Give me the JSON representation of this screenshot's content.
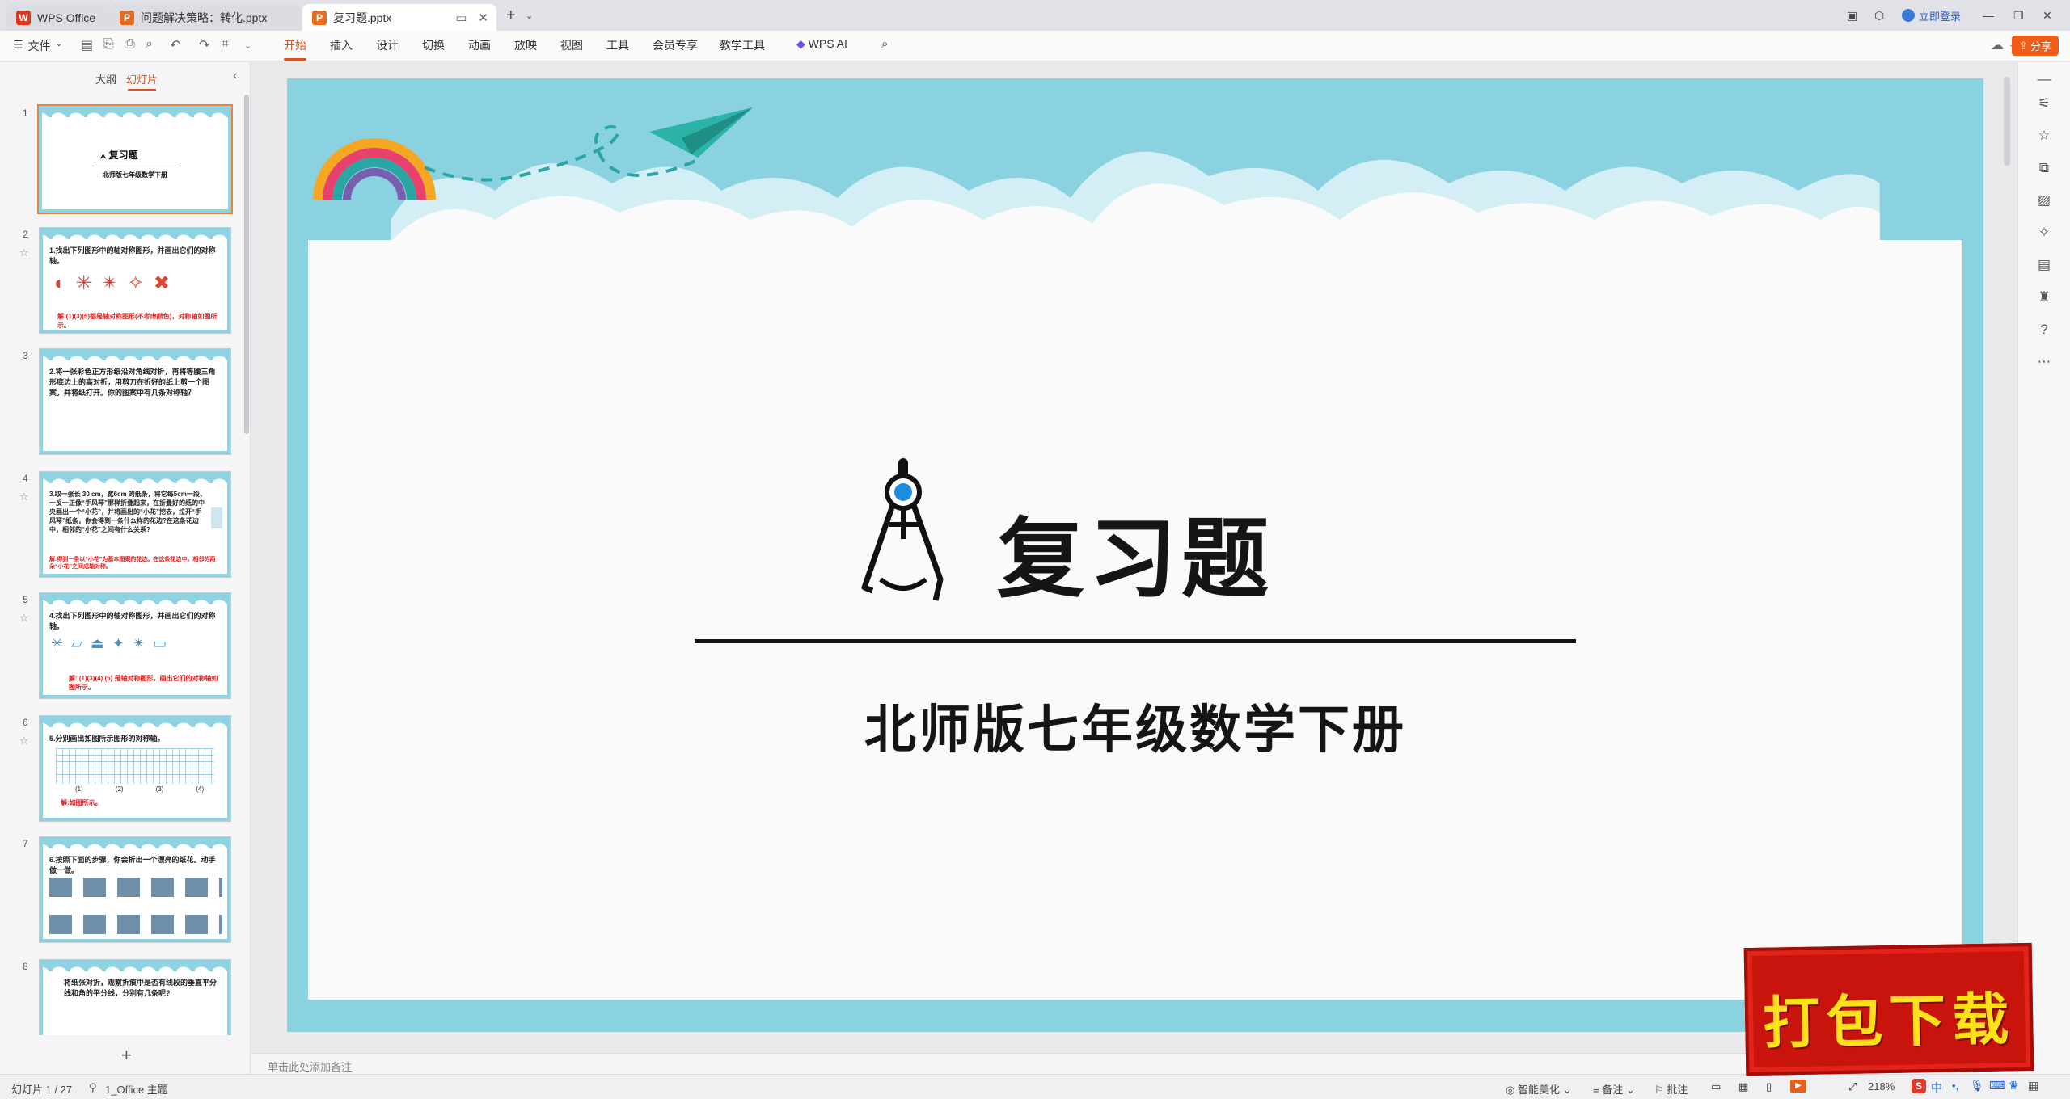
{
  "tabs": [
    {
      "label": "WPS Office",
      "icon": "wps-logo-icon",
      "color": "#e0361b"
    },
    {
      "label": "问题解决策略：转化.pptx",
      "icon": "ppt-file-icon",
      "color": "#e96b1c"
    },
    {
      "label": "复习题.pptx",
      "icon": "ppt-file-icon",
      "color": "#e96b1c"
    }
  ],
  "titlebar": {
    "login_label": "立即登录"
  },
  "ribbon": {
    "file_label": "文件",
    "menus": [
      "开始",
      "插入",
      "设计",
      "切换",
      "动画",
      "放映",
      "视图",
      "工具",
      "会员专享",
      "教学工具"
    ],
    "active_menu": "开始",
    "ai_label": "WPS AI",
    "share_label": "分享",
    "accent": "#d9531e"
  },
  "left_panel": {
    "tab_outline": "大纲",
    "tab_slides": "幻灯片",
    "slides": [
      {
        "num": "1",
        "title": "复习题",
        "subtitle": "北师版七年级数学下册"
      },
      {
        "num": "2",
        "text": "1.找出下列图形中的轴对称图形，并画出它们的对称轴。",
        "red": "解:(1)(3)(5)都是轴对称图形(不考虑颜色)，对称轴如图所示。"
      },
      {
        "num": "3",
        "text": "2.将一张彩色正方形纸沿对角线对折，再将等腰三角形底边上的高对折，用剪刀在折好的纸上剪一个图案，并将纸打开。你的图案中有几条对称轴？"
      },
      {
        "num": "4",
        "text": "3.取一张长 30 cm，宽6cm 的纸条，将它每5cm一段，一反一正像“手风琴”那样折叠起来，在折叠好的纸的中央画出一个“小花”，并将画出的“小花”挖去，拉开“手风琴”纸条，你会得到一条什么样的花边?在这条花边中，相邻的“小花”之间有什么关系?",
        "red": "解:得到一条以“小花”为基本图案的花边。在这条花边中，相邻的两朵“小花”之间成轴对称。"
      },
      {
        "num": "5",
        "text": "4.找出下列图形中的轴对称图形，并画出它们的对称轴。",
        "red": "解: (1)(3)(4) (5) 是轴对称图形，画出它们的对称轴如图所示。"
      },
      {
        "num": "6",
        "text": "5.分别画出如图所示图形的对称轴。",
        "labels": [
          "(1)",
          "(2)",
          "(3)",
          "(4)"
        ],
        "red": "解:如图所示。"
      },
      {
        "num": "7",
        "text": "6.按照下面的步骤，你会折出一个漂亮的纸花。动手做一做。"
      },
      {
        "num": "8",
        "text": "将纸张对折，观察折痕中是否有线段的垂直平分线和角的平分线，分别有几条呢?"
      }
    ],
    "add_icon": "+"
  },
  "slide": {
    "title": "复习题",
    "subtitle": "北师版七年级数学下册",
    "bg_color": "#8bd2e0",
    "icon": "compass-icon"
  },
  "notes_placeholder": "单击此处添加备注",
  "statusbar": {
    "slide_counter": "幻灯片 1 / 27",
    "theme": "1_Office 主题",
    "smart_beautify": "智能美化",
    "notes_label": "备注",
    "comments_label": "批注",
    "zoom": "218%",
    "ime": "中"
  },
  "badge": {
    "text": "打包下载"
  }
}
